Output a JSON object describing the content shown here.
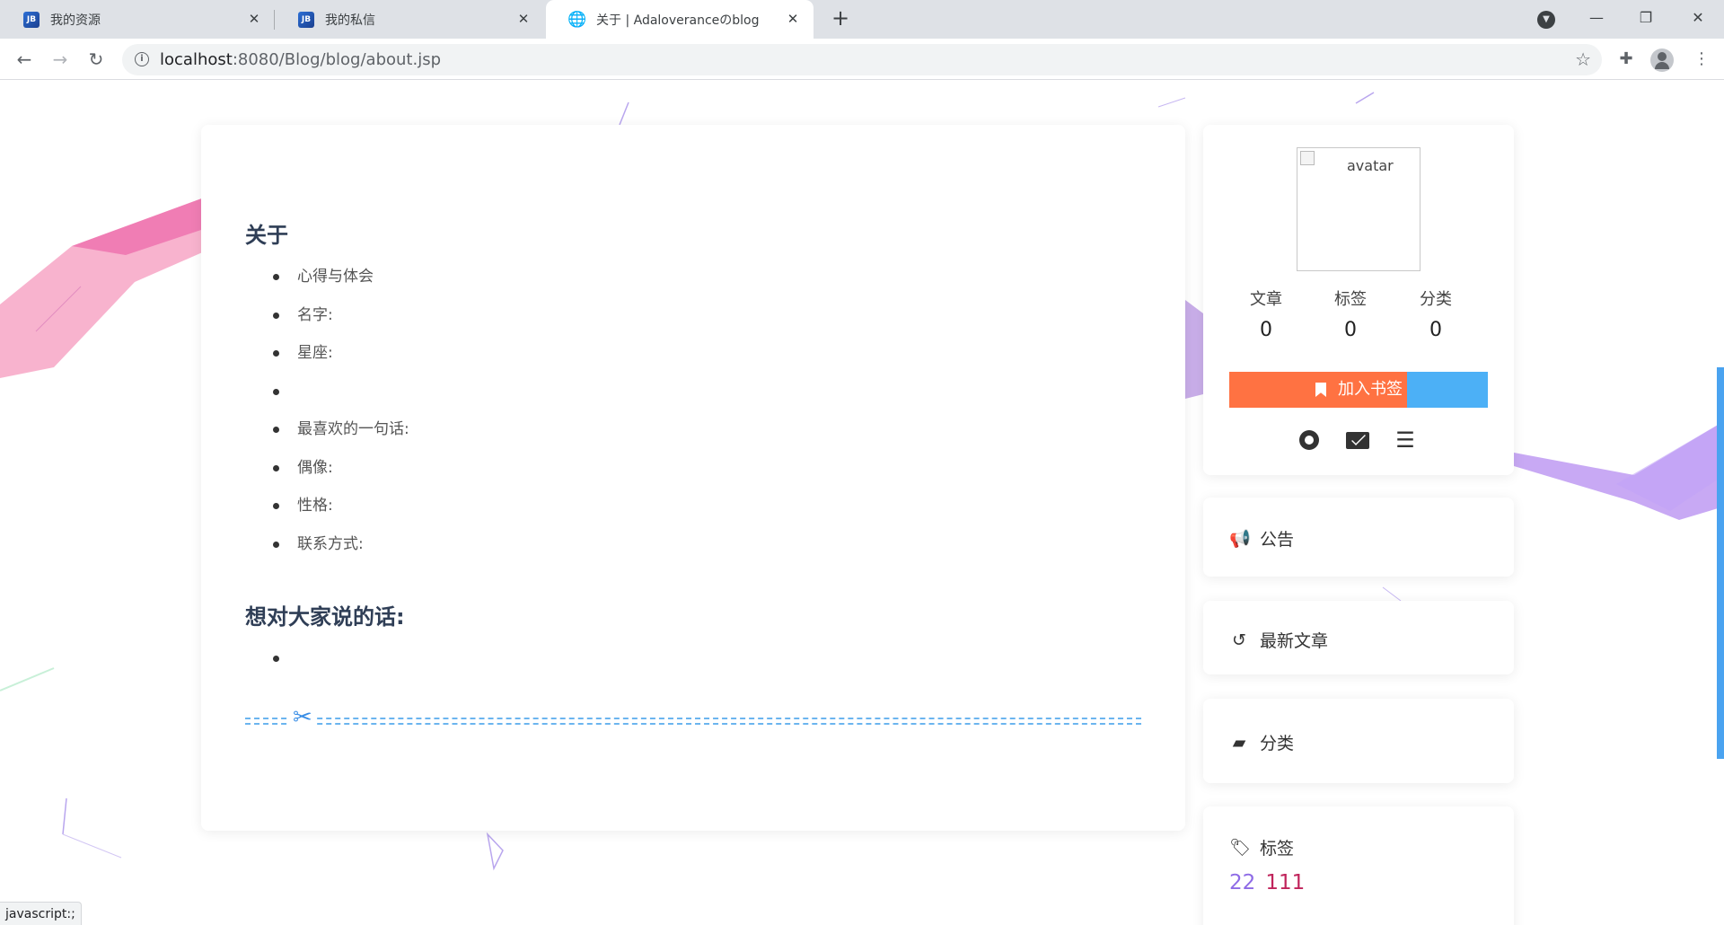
{
  "browser": {
    "tabs": [
      {
        "title": "我的资源",
        "favicon": "jb-favicon"
      },
      {
        "title": "我的私信",
        "favicon": "jb-favicon"
      },
      {
        "title": "关于 | Adaloveranceのblog",
        "favicon": "globe-icon",
        "active": true
      }
    ],
    "new_tab_label": "+",
    "url_host": "localhost",
    "url_path": ":8080/Blog/blog/about.jsp",
    "status_link": "javascript:;"
  },
  "main": {
    "about_heading": "关于",
    "about_items": [
      "心得与体会",
      "名字:",
      "星座:",
      "",
      "最喜欢的一句话:",
      "偶像:",
      "性格:",
      "联系方式:"
    ],
    "words_heading": "想对大家说的话:",
    "words_items": [
      ""
    ]
  },
  "profile": {
    "avatar_alt": "avatar",
    "stats": [
      {
        "label": "文章",
        "value": "0"
      },
      {
        "label": "标签",
        "value": "0"
      },
      {
        "label": "分类",
        "value": "0"
      }
    ],
    "bookmark_label": "加入书签",
    "social_icons": [
      "github-icon",
      "envelope-icon",
      "rss-icon"
    ]
  },
  "sidebar": {
    "notice_title": "公告",
    "recent_title": "最新文章",
    "category_title": "分类",
    "tags_title": "标签",
    "tags": [
      {
        "name": "22",
        "color": "#8e6be6"
      },
      {
        "name": "111",
        "color": "#c0245b"
      }
    ]
  },
  "colors": {
    "bookmark_orange": "#ff7242",
    "bookmark_blue": "#4cb0f6",
    "notice_red": "#e02020",
    "heading": "#2f3e56",
    "cut_line": "#6bb5ef"
  }
}
